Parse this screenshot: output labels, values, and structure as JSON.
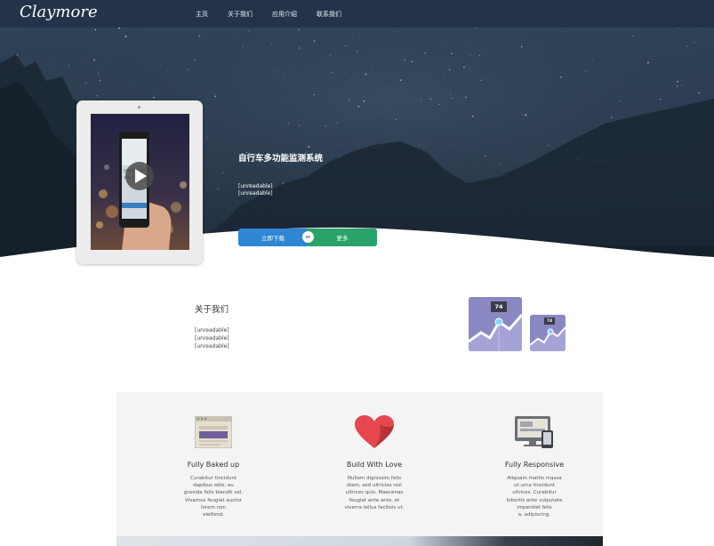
{
  "nav": {
    "logo": "Claymore",
    "links": [
      "主页",
      "关于我们",
      "应用介绍",
      "联系我们"
    ]
  },
  "hero": {
    "title": "自行车多功能监测系统",
    "sub1": "[unreadable]",
    "sub2": "[unreadable]",
    "download_label": "立即下载",
    "or_label": "or",
    "more_label": "更多"
  },
  "about": {
    "title": "关于我们",
    "lines": [
      "[unreadable]",
      "[unreadable]",
      "[unreadable]"
    ],
    "stats": [
      "74",
      "74"
    ]
  },
  "features": [
    {
      "title": "Fully Baked up",
      "desc": [
        "Curabitur tincidunt",
        "dapibus odio, eu",
        "gravida felis blandit vel.",
        "Vivamus feugiat auctor",
        "lorem non",
        "eleifend."
      ]
    },
    {
      "title": "Build With Love",
      "desc": [
        "Nullam dignissim felis",
        "diam, sed ultricies nisl",
        "ultrices quis. Maecenas",
        "feugiat ante ante, et",
        "viverra tellus facilisis ut."
      ]
    },
    {
      "title": "Fully Responsive",
      "desc": [
        "Aliquam mattis massa",
        "ut urna tincidunt",
        "ultrices. Curabitur",
        "lobortis ante vulputate",
        "imperdiet felis",
        "a, adipiscing."
      ]
    }
  ],
  "colors": {
    "nav_bg": "#23344a",
    "download": "#2e86d4",
    "more": "#2aa36b",
    "stat_card": "#8a88c2"
  }
}
